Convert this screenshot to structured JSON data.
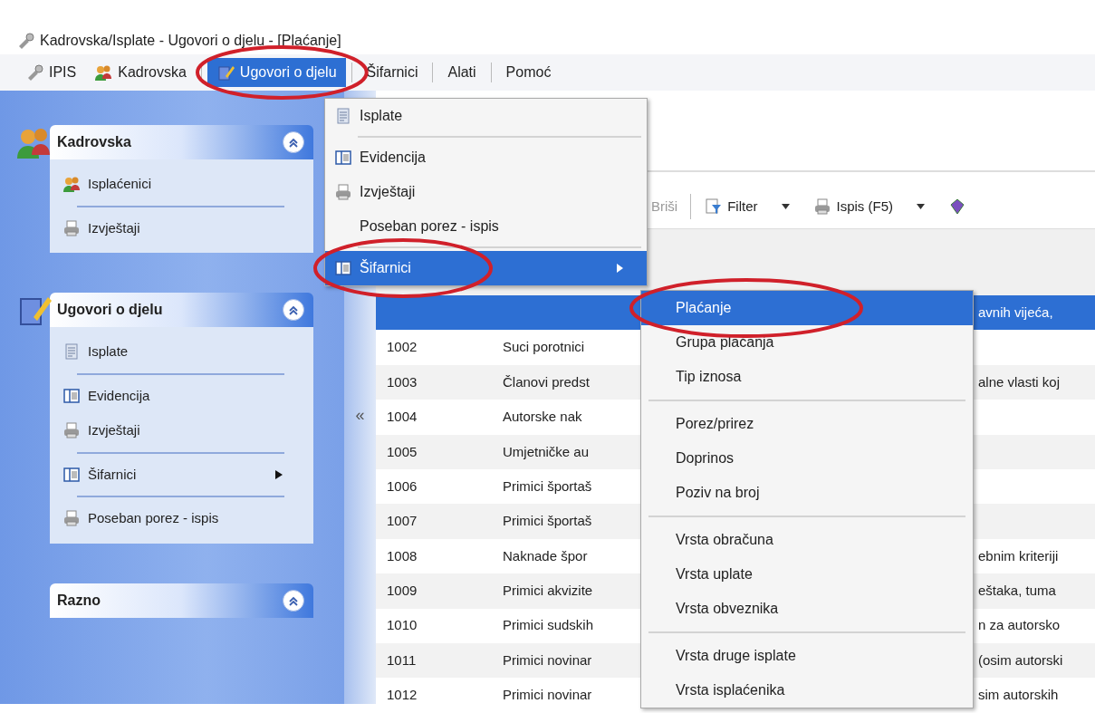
{
  "window": {
    "title": "Kadrovska/Isplate - Ugovori o djelu - [Plaćanje]"
  },
  "menubar": [
    {
      "label": "IPIS",
      "selected": false,
      "circled": false
    },
    {
      "label": "Kadrovska",
      "selected": false,
      "circled": false
    },
    {
      "label": "Ugovori o djelu",
      "selected": true,
      "circled": true
    },
    {
      "label": "Šifarnici",
      "selected": false,
      "circled": false
    },
    {
      "label": "Alati",
      "selected": false,
      "circled": false
    },
    {
      "label": "Pomoć",
      "selected": false,
      "circled": false
    }
  ],
  "sidebar": {
    "panels": [
      {
        "title": "Kadrovska",
        "groups": [
          [
            {
              "label": "Isplaćenici",
              "submenu": false
            }
          ],
          [
            {
              "label": "Izvještaji",
              "submenu": false
            }
          ]
        ]
      },
      {
        "title": "Ugovori o djelu",
        "groups": [
          [
            {
              "label": "Isplate",
              "submenu": false
            }
          ],
          [
            {
              "label": "Evidencija",
              "submenu": false
            },
            {
              "label": "Izvještaji",
              "submenu": false
            }
          ],
          [
            {
              "label": "Šifarnici",
              "submenu": true
            }
          ],
          [
            {
              "label": "Poseban porez - ispis",
              "submenu": false
            }
          ]
        ]
      },
      {
        "title": "Razno"
      }
    ]
  },
  "splitter": {
    "label": "«"
  },
  "toolbar": [
    {
      "label": "Briši",
      "disabled": true,
      "dropdown": false
    },
    {
      "label": "Filter",
      "disabled": false,
      "dropdown": true
    },
    {
      "label": "Ispis (F5)",
      "disabled": false,
      "dropdown": true
    },
    {
      "disabled": false,
      "dropdown": false
    }
  ],
  "table": {
    "rows": [
      {
        "column_3": "avnih vijeća,",
        "selected": true
      },
      {
        "code": "1002",
        "name": "Suci porotnici",
        "selected": false
      },
      {
        "code": "1003",
        "name": "Članovi predst",
        "column_3": "alne vlasti koj",
        "selected": false
      },
      {
        "code": "1004",
        "name": "Autorske nak",
        "selected": false
      },
      {
        "code": "1005",
        "name": "Umjetničke au",
        "selected": false
      },
      {
        "code": "1006",
        "name": "Primici športaš",
        "selected": false
      },
      {
        "code": "1007",
        "name": "Primici športaš",
        "selected": false
      },
      {
        "code": "1008",
        "name": "Naknade špor",
        "column_3": "ebnim kriteriji",
        "selected": false
      },
      {
        "code": "1009",
        "name": "Primici akvizite",
        "column_3": "eštaka, tuma",
        "selected": false
      },
      {
        "code": "1010",
        "name": "Primici sudskih",
        "column_3": "n za autorsko",
        "selected": false
      },
      {
        "code": "1011",
        "name": "Primici novinar",
        "column_3": "(osim autorski",
        "selected": false
      },
      {
        "code": "1012",
        "name": "Primici novinar",
        "column_3": "sim autorskih",
        "selected": false
      }
    ]
  },
  "dropdown": {
    "groups": [
      [
        {
          "label": "Isplate",
          "selected": false,
          "submenu": false,
          "circled": false
        }
      ],
      [
        {
          "label": "Evidencija",
          "selected": false,
          "submenu": false,
          "circled": false
        },
        {
          "label": "Izvještaji",
          "selected": false,
          "submenu": false,
          "circled": false
        },
        {
          "label": "Poseban porez - ispis",
          "selected": false,
          "submenu": false,
          "circled": false
        }
      ],
      [
        {
          "label": "Šifarnici",
          "selected": true,
          "submenu": true,
          "circled": true
        }
      ]
    ]
  },
  "submenu": {
    "groups": [
      [
        {
          "label": "Plaćanje",
          "selected": true,
          "circled": true
        },
        {
          "label": "Grupa plaćanja",
          "selected": false,
          "circled": false
        },
        {
          "label": "Tip iznosa",
          "selected": false,
          "circled": false
        }
      ],
      [
        {
          "label": "Porez/prirez",
          "selected": false,
          "circled": false
        },
        {
          "label": "Doprinos",
          "selected": false,
          "circled": false
        },
        {
          "label": "Poziv na broj",
          "selected": false,
          "circled": false
        }
      ],
      [
        {
          "label": "Vrsta obračuna",
          "selected": false,
          "circled": false
        },
        {
          "label": "Vrsta uplate",
          "selected": false,
          "circled": false
        },
        {
          "label": "Vrsta obveznika",
          "selected": false,
          "circled": false
        }
      ],
      [
        {
          "label": "Vrsta druge isplate",
          "selected": false,
          "circled": false
        },
        {
          "label": "Vrsta isplaćenika",
          "selected": false,
          "circled": false
        }
      ]
    ]
  }
}
